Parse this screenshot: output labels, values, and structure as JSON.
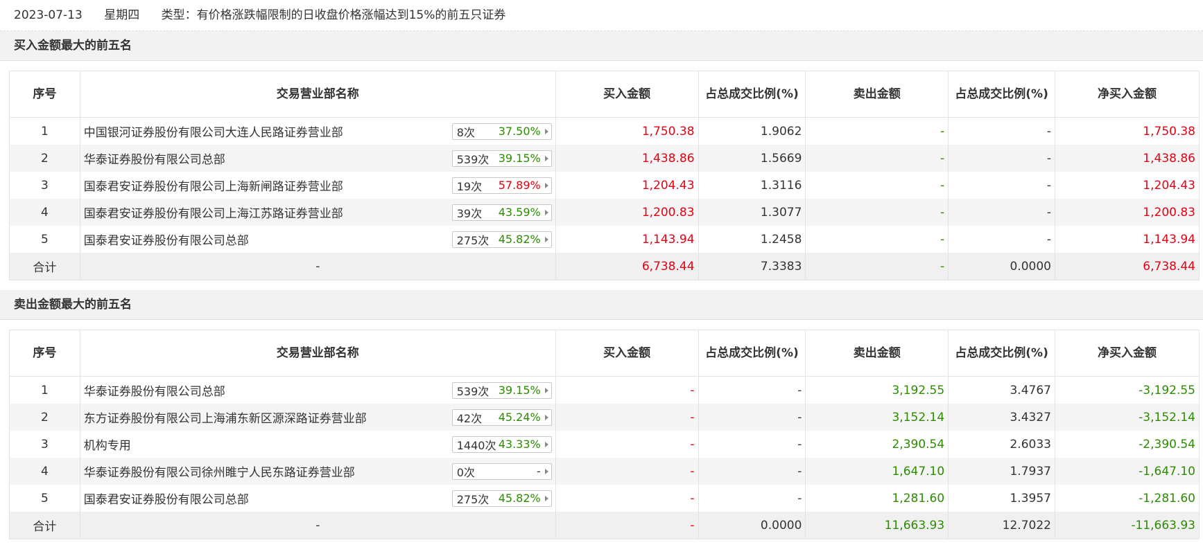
{
  "header": {
    "date": "2023-07-13",
    "weekday": "星期四",
    "type_text": "类型：有价格涨跌幅限制的日收盘价格涨幅达到15%的前五只证券"
  },
  "columns": {
    "seq": "序号",
    "dept": "交易营业部名称",
    "buy": "买入金额",
    "buy_ratio": "占总成交比例(%)",
    "sell": "卖出金额",
    "sell_ratio": "占总成交比例(%)",
    "net": "净买入金额"
  },
  "buy_section": {
    "title": "买入金额最大的前五名",
    "rows": [
      {
        "seq": "1",
        "name": "中国银河证券股份有限公司大连人民路证券营业部",
        "count": "8次",
        "pct": "37.50%",
        "buy": "1,750.38",
        "buy_ratio": "1.9062",
        "sell": "-",
        "sell_ratio": "-",
        "net": "1,750.38"
      },
      {
        "seq": "2",
        "name": "华泰证券股份有限公司总部",
        "count": "539次",
        "pct": "39.15%",
        "buy": "1,438.86",
        "buy_ratio": "1.5669",
        "sell": "-",
        "sell_ratio": "-",
        "net": "1,438.86"
      },
      {
        "seq": "3",
        "name": "国泰君安证券股份有限公司上海新闸路证券营业部",
        "count": "19次",
        "pct": "57.89%",
        "buy": "1,204.43",
        "buy_ratio": "1.3116",
        "sell": "-",
        "sell_ratio": "-",
        "net": "1,204.43"
      },
      {
        "seq": "4",
        "name": "国泰君安证券股份有限公司上海江苏路证券营业部",
        "count": "39次",
        "pct": "43.59%",
        "buy": "1,200.83",
        "buy_ratio": "1.3077",
        "sell": "-",
        "sell_ratio": "-",
        "net": "1,200.83"
      },
      {
        "seq": "5",
        "name": "国泰君安证券股份有限公司总部",
        "count": "275次",
        "pct": "45.82%",
        "buy": "1,143.94",
        "buy_ratio": "1.2458",
        "sell": "-",
        "sell_ratio": "-",
        "net": "1,143.94"
      }
    ],
    "total": {
      "label": "合计",
      "name": "-",
      "buy": "6,738.44",
      "buy_ratio": "7.3383",
      "sell": "-",
      "sell_ratio": "0.0000",
      "net": "6,738.44"
    }
  },
  "sell_section": {
    "title": "卖出金额最大的前五名",
    "rows": [
      {
        "seq": "1",
        "name": "华泰证券股份有限公司总部",
        "count": "539次",
        "pct": "39.15%",
        "buy": "-",
        "buy_ratio": "-",
        "sell": "3,192.55",
        "sell_ratio": "3.4767",
        "net": "-3,192.55"
      },
      {
        "seq": "2",
        "name": "东方证券股份有限公司上海浦东新区源深路证券营业部",
        "count": "42次",
        "pct": "45.24%",
        "buy": "-",
        "buy_ratio": "-",
        "sell": "3,152.14",
        "sell_ratio": "3.4327",
        "net": "-3,152.14"
      },
      {
        "seq": "3",
        "name": "机构专用",
        "count": "1440次",
        "pct": "43.33%",
        "buy": "-",
        "buy_ratio": "-",
        "sell": "2,390.54",
        "sell_ratio": "2.6033",
        "net": "-2,390.54"
      },
      {
        "seq": "4",
        "name": "华泰证券股份有限公司徐州睢宁人民东路证券营业部",
        "count": "0次",
        "pct": "-",
        "buy": "-",
        "buy_ratio": "-",
        "sell": "1,647.10",
        "sell_ratio": "1.7937",
        "net": "-1,647.10"
      },
      {
        "seq": "5",
        "name": "国泰君安证券股份有限公司总部",
        "count": "275次",
        "pct": "45.82%",
        "buy": "-",
        "buy_ratio": "-",
        "sell": "1,281.60",
        "sell_ratio": "1.3957",
        "net": "-1,281.60"
      }
    ],
    "total": {
      "label": "合计",
      "name": "-",
      "buy": "-",
      "buy_ratio": "0.0000",
      "sell": "11,663.93",
      "sell_ratio": "12.7022",
      "net": "-11,663.93"
    }
  },
  "colors": {
    "rise": "#e60012",
    "fall": "#2c8b00"
  }
}
